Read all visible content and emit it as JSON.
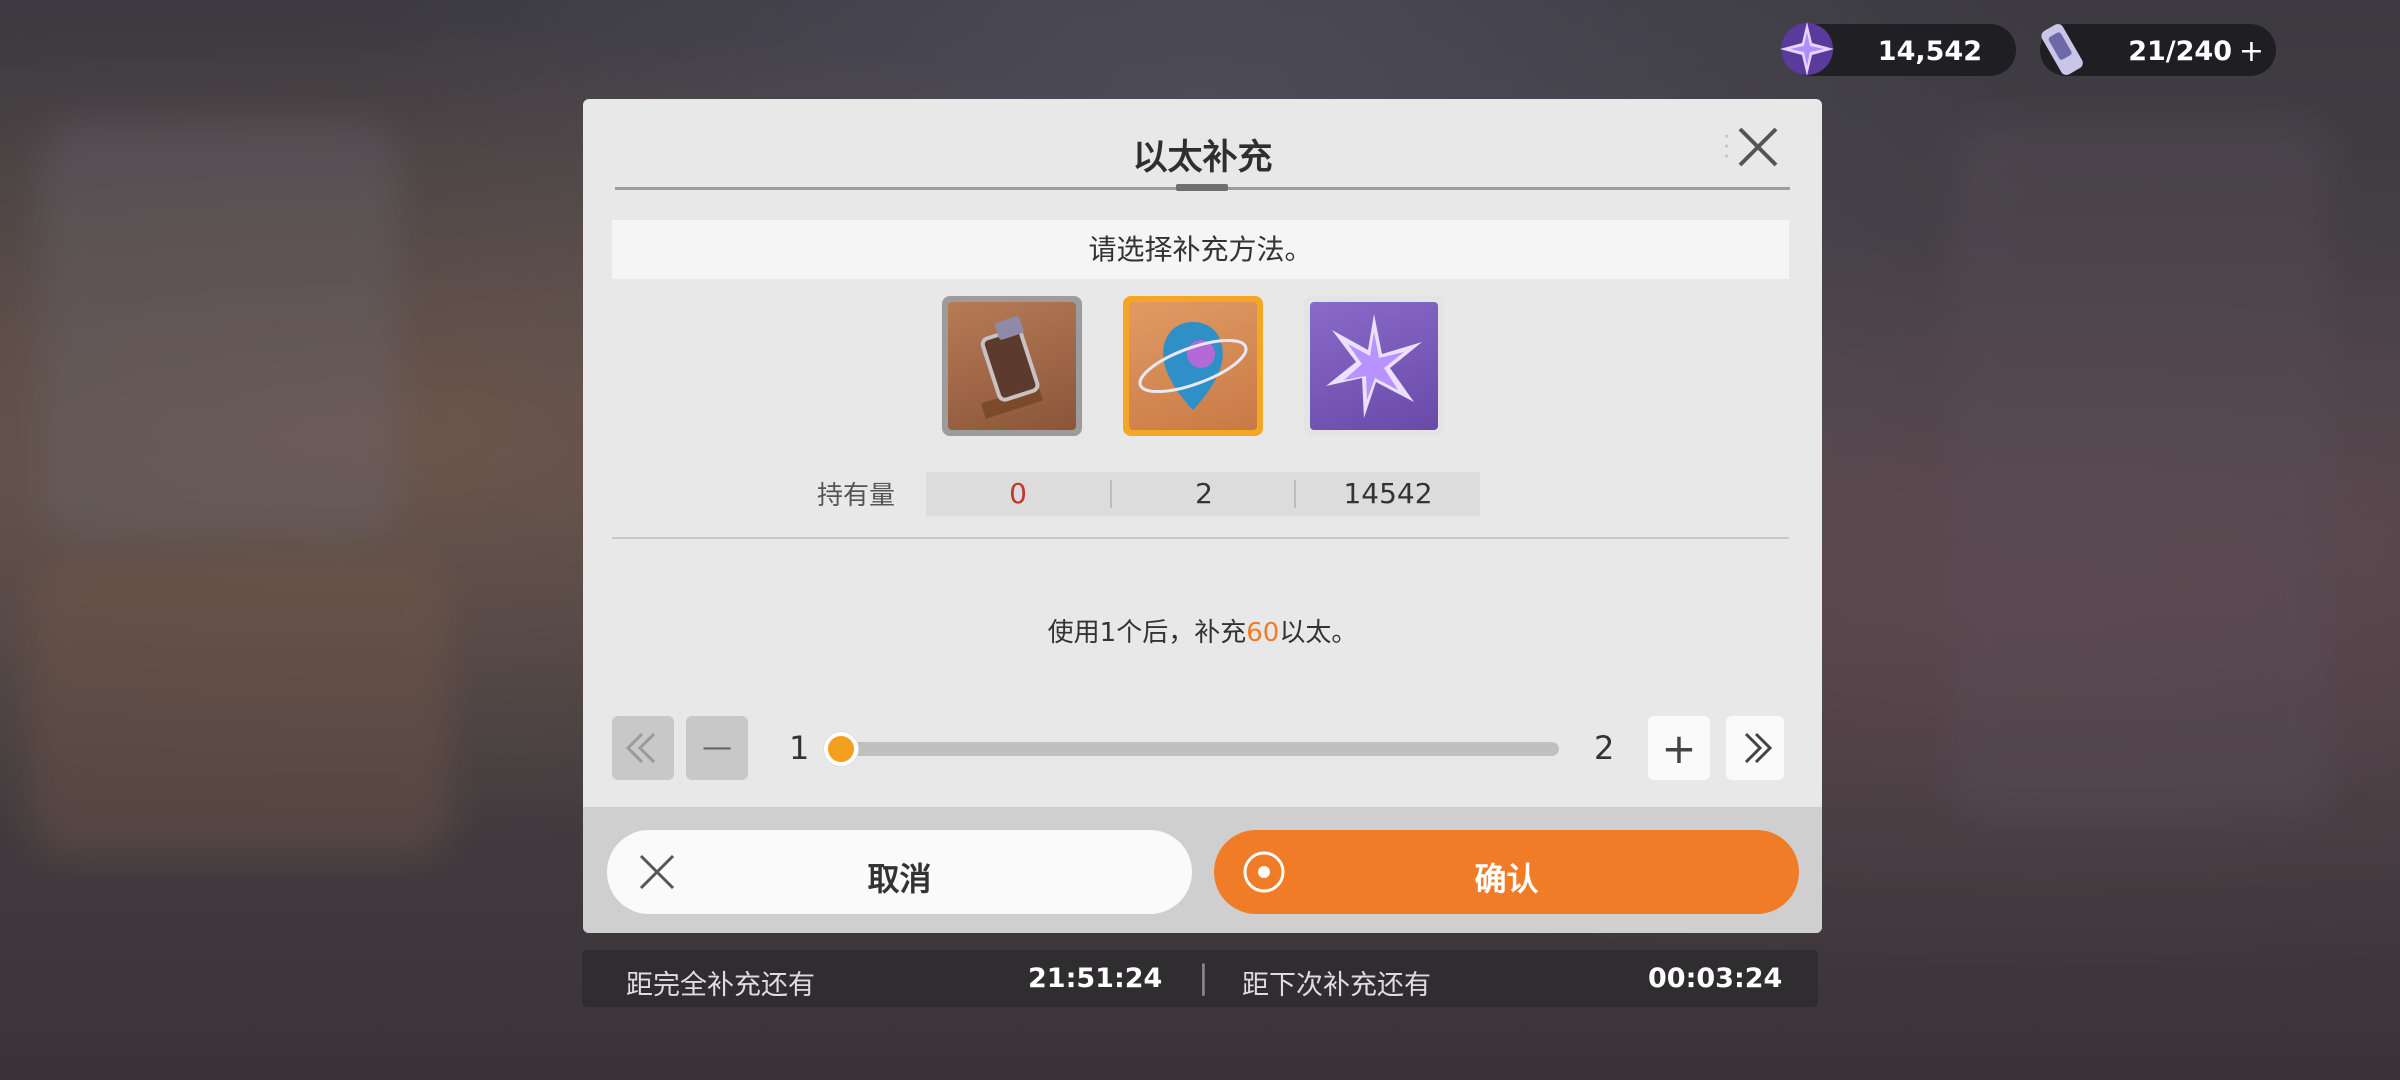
{
  "currency": [
    {
      "name": "star-crystal",
      "value": "14,542"
    },
    {
      "name": "ether-battery",
      "value": "21/240",
      "add": "+"
    }
  ],
  "dialog": {
    "title": "以太补充",
    "prompt": "请选择补充方法。",
    "holdings_label": "持有量",
    "holdings": [
      "0",
      "2",
      "14542"
    ],
    "description": {
      "pre": "使用1个后，补充",
      "amount": "60",
      "post": "以太。"
    },
    "quantity": {
      "min": "1",
      "max": "2",
      "selected": 1
    },
    "minus": "—",
    "plus": "+"
  },
  "buttons": {
    "cancel": "取消",
    "confirm": "确认"
  },
  "timers": {
    "full_label": "距完全补充还有",
    "full_value": "21:51:24",
    "next_label": "距下次补充还有",
    "next_value": "00:03:24"
  },
  "colors": {
    "accent": "#f07c27",
    "selected_border": "#f5a623",
    "zero_value": "#c0392b"
  }
}
